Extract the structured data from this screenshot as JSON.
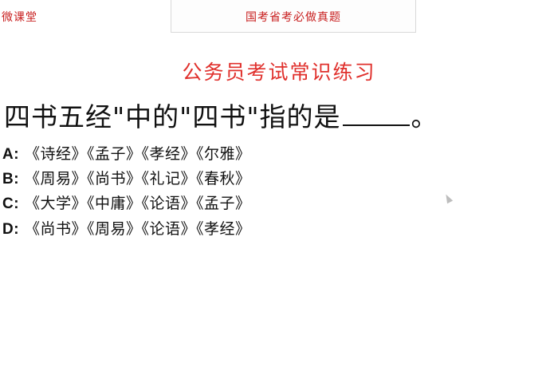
{
  "header": {
    "brand": "微课堂",
    "banner": "国考省考必做真题"
  },
  "title": "公务员考试常识练习",
  "question": {
    "before_blank": "四书五经\"中的\"四书\"指的是",
    "after_blank": "。"
  },
  "options": [
    {
      "letter": "A:",
      "text": "《诗经》《孟子》《孝经》《尔雅》"
    },
    {
      "letter": "B:",
      "text": "《周易》《尚书》《礼记》《春秋》"
    },
    {
      "letter": "C:",
      "text": "《大学》《中庸》《论语》《孟子》"
    },
    {
      "letter": "D:",
      "text": "《尚书》《周易》《论语》《孝经》"
    }
  ],
  "colors": {
    "accent_red": "#c81e1e",
    "title_red": "#e0302c",
    "text": "#111111"
  },
  "icons": {
    "cursor": "mouse-pointer-icon"
  }
}
